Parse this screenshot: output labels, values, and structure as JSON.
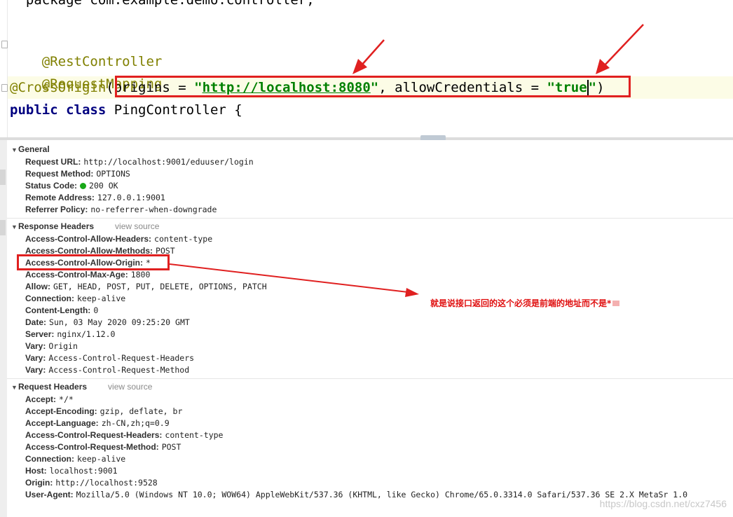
{
  "editor": {
    "cut_line": "  package com.example.demo.controller;",
    "line1": "@RestController",
    "line2": "@RequestMapping",
    "line3_anno": "@CrossOrigin",
    "line3_paren_open": "(",
    "line3_origins": "origins = ",
    "line3_origins_q1": "\"",
    "line3_origins_url": "http://localhost:8080",
    "line3_origins_q2": "\"",
    "line3_sep": ", allowCredentials = ",
    "line3_cred_val": "\"true",
    "line3_cred_q": "\"",
    "line3_paren_close": ")",
    "line4_kw": "public class",
    "line4_rest": " PingController {"
  },
  "devtools": {
    "general": {
      "title": "General",
      "rows": [
        {
          "k": "Request URL:",
          "v": "http://localhost:9001/eduuser/login"
        },
        {
          "k": "Request Method:",
          "v": "OPTIONS"
        },
        {
          "k": "Status Code:",
          "v": "200 OK"
        },
        {
          "k": "Remote Address:",
          "v": "127.0.0.1:9001"
        },
        {
          "k": "Referrer Policy:",
          "v": "no-referrer-when-downgrade"
        }
      ]
    },
    "response": {
      "title": "Response Headers",
      "view_source": "view source",
      "rows": [
        {
          "k": "Access-Control-Allow-Headers:",
          "v": "content-type"
        },
        {
          "k": "Access-Control-Allow-Methods:",
          "v": "POST"
        },
        {
          "k": "Access-Control-Allow-Origin:",
          "v": "*"
        },
        {
          "k": "Access-Control-Max-Age:",
          "v": "1800"
        },
        {
          "k": "Allow:",
          "v": "GET, HEAD, POST, PUT, DELETE, OPTIONS, PATCH"
        },
        {
          "k": "Connection:",
          "v": "keep-alive"
        },
        {
          "k": "Content-Length:",
          "v": "0"
        },
        {
          "k": "Date:",
          "v": "Sun, 03 May 2020 09:25:20 GMT"
        },
        {
          "k": "Server:",
          "v": "nginx/1.12.0"
        },
        {
          "k": "Vary:",
          "v": "Origin"
        },
        {
          "k": "Vary:",
          "v": "Access-Control-Request-Headers"
        },
        {
          "k": "Vary:",
          "v": "Access-Control-Request-Method"
        }
      ]
    },
    "request": {
      "title": "Request Headers",
      "view_source": "view source",
      "rows": [
        {
          "k": "Accept:",
          "v": "*/*"
        },
        {
          "k": "Accept-Encoding:",
          "v": "gzip, deflate, br"
        },
        {
          "k": "Accept-Language:",
          "v": "zh-CN,zh;q=0.9"
        },
        {
          "k": "Access-Control-Request-Headers:",
          "v": "content-type"
        },
        {
          "k": "Access-Control-Request-Method:",
          "v": "POST"
        },
        {
          "k": "Connection:",
          "v": "keep-alive"
        },
        {
          "k": "Host:",
          "v": "localhost:9001"
        },
        {
          "k": "Origin:",
          "v": "http://localhost:9528"
        },
        {
          "k": "User-Agent:",
          "v": "Mozilla/5.0 (Windows NT 10.0; WOW64) AppleWebKit/537.36 (KHTML, like Gecko) Chrome/65.0.3314.0 Safari/537.36 SE 2.X MetaSr 1.0"
        }
      ]
    }
  },
  "annotation": {
    "note": "就是说接口返回的这个必须是前端的地址而不是*"
  },
  "watermark": "https://blog.csdn.net/cxz7456",
  "colors": {
    "annotation_red": "#e02020",
    "status_green": "#18a818",
    "java_annotation": "#808000",
    "java_keyword": "#000080",
    "java_string": "#008000"
  }
}
